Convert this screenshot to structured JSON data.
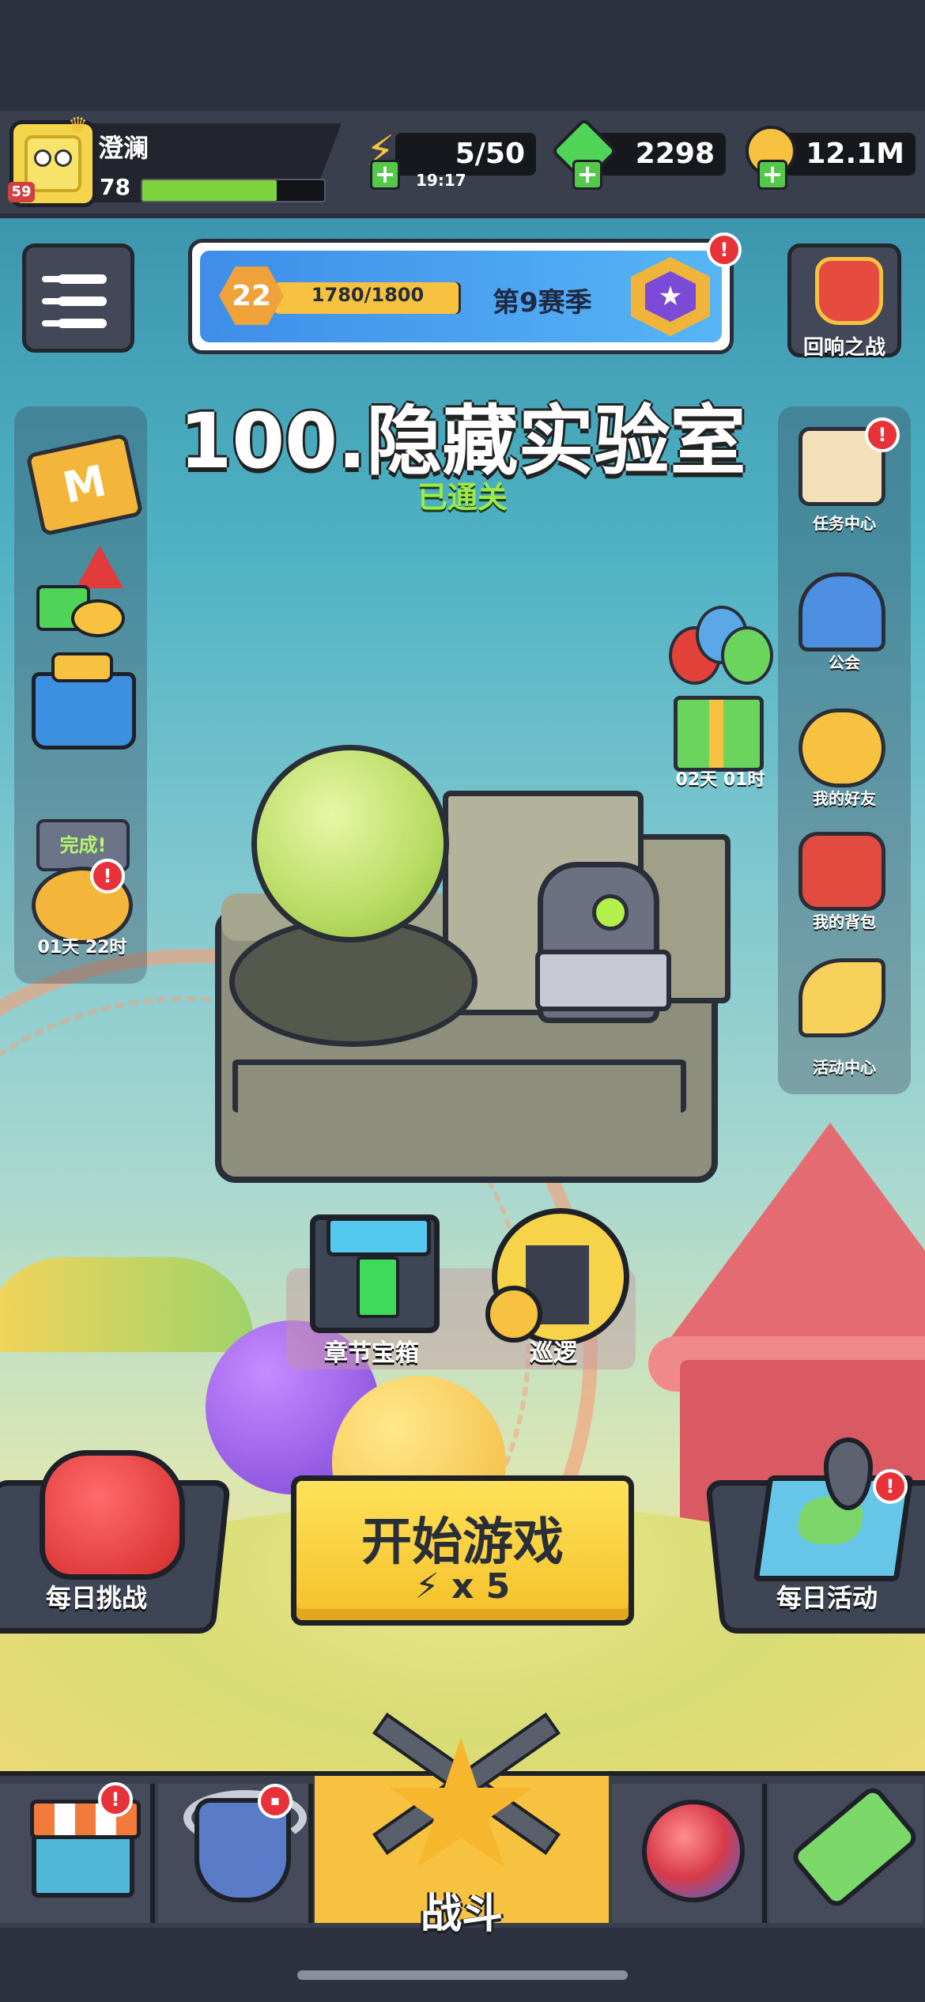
{
  "player": {
    "name": "澄澜",
    "avatar_level": "59",
    "level": "78",
    "xp_fraction": 0.74
  },
  "resources": {
    "energy": {
      "value": "5/50",
      "timer": "19:17",
      "icon": "lightning-icon",
      "color": "#f6c23f"
    },
    "gems": {
      "value": "2298",
      "icon": "green-gem-icon",
      "color": "#4fd457"
    },
    "coins": {
      "value": "12.1M",
      "icon": "gold-coin-icon",
      "color": "#f6c23f"
    }
  },
  "season": {
    "level": "22",
    "progress_text": "1780/1800",
    "progress_fraction": 0.989,
    "name": "第9赛季",
    "alert": "!"
  },
  "echo_battle": {
    "label": "回响之战"
  },
  "chapter": {
    "title": "100.隐藏实验室",
    "status": "已通关"
  },
  "left_panel": {
    "bubble": "完成!",
    "pig_timer": "01天 22时",
    "alert": "!"
  },
  "right_panel": {
    "items": [
      {
        "label": "任务中心",
        "icon": "scroll-icon",
        "alert": "!"
      },
      {
        "label": "公会",
        "icon": "guild-house-icon"
      },
      {
        "label": "我的好友",
        "icon": "friends-icon"
      },
      {
        "label": "我的背包",
        "icon": "backpack-icon"
      },
      {
        "label": "活动中心",
        "icon": "party-horn-icon"
      }
    ]
  },
  "gift": {
    "timer": "02天 01时"
  },
  "shortcuts": {
    "chest_label": "章节宝箱",
    "patrol_label": "巡逻"
  },
  "actions": {
    "daily_challenge": "每日挑战",
    "daily_activity": "每日活动",
    "activity_alert": "!"
  },
  "start": {
    "label": "开始游戏",
    "cost": "x 5"
  },
  "nav": {
    "shop_alert": "!",
    "battle_label": "战斗"
  },
  "colors": {
    "accent_yellow": "#f6c23f",
    "alert_red": "#e8323a",
    "panel_dark": "#3a3f4d"
  }
}
